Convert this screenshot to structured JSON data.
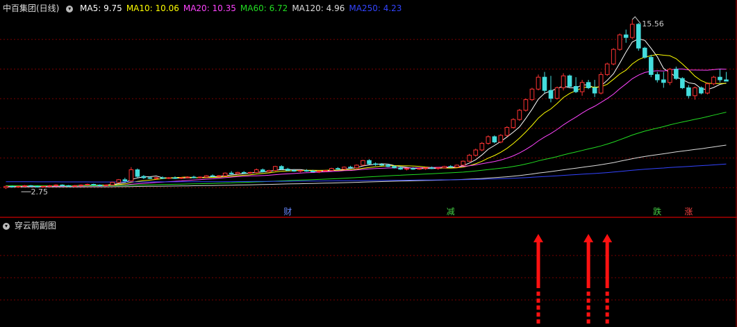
{
  "header": {
    "stock_name": "中百集团(日线)",
    "ma_labels": [
      {
        "label": "MA5: 9.75",
        "color": "#ffffff"
      },
      {
        "label": "MA10: 10.06",
        "color": "#ffff00"
      },
      {
        "label": "MA20: 10.35",
        "color": "#ff44ff"
      },
      {
        "label": "MA60: 6.72",
        "color": "#22dd22"
      },
      {
        "label": "MA120: 4.96",
        "color": "#dddddd"
      },
      {
        "label": "MA250: 4.23",
        "color": "#3344ff"
      }
    ]
  },
  "sub_panel": {
    "title": "穿云箭副图"
  },
  "chart_data": {
    "type": "candlestick",
    "price_ylim": [
      1.5,
      16.3
    ],
    "high_label": "15.56",
    "low_label": "2.75",
    "colors": {
      "up": "#ff3333",
      "down": "#44dddd",
      "grid": "#7a0000",
      "border": "#aa0000"
    },
    "candles": [
      {
        "o": 2.85,
        "h": 3.0,
        "l": 2.75,
        "c": 2.95
      },
      {
        "o": 2.95,
        "h": 3.0,
        "l": 2.85,
        "c": 2.9
      },
      {
        "o": 2.9,
        "h": 3.0,
        "l": 2.85,
        "c": 2.95
      },
      {
        "o": 2.95,
        "h": 3.05,
        "l": 2.9,
        "c": 3.0
      },
      {
        "o": 3.0,
        "h": 3.05,
        "l": 2.9,
        "c": 2.95
      },
      {
        "o": 2.95,
        "h": 3.0,
        "l": 2.85,
        "c": 2.9
      },
      {
        "o": 2.9,
        "h": 3.0,
        "l": 2.85,
        "c": 2.95
      },
      {
        "o": 2.95,
        "h": 3.05,
        "l": 2.9,
        "c": 3.0
      },
      {
        "o": 3.0,
        "h": 3.1,
        "l": 2.95,
        "c": 3.05
      },
      {
        "o": 3.05,
        "h": 3.1,
        "l": 2.95,
        "c": 3.0
      },
      {
        "o": 3.0,
        "h": 3.05,
        "l": 2.9,
        "c": 2.95
      },
      {
        "o": 2.95,
        "h": 3.05,
        "l": 2.9,
        "c": 3.0
      },
      {
        "o": 3.0,
        "h": 3.1,
        "l": 2.95,
        "c": 3.05
      },
      {
        "o": 3.05,
        "h": 3.15,
        "l": 3.0,
        "c": 3.1
      },
      {
        "o": 3.1,
        "h": 3.15,
        "l": 3.0,
        "c": 3.05
      },
      {
        "o": 3.05,
        "h": 3.1,
        "l": 2.95,
        "c": 3.0
      },
      {
        "o": 3.0,
        "h": 3.1,
        "l": 2.95,
        "c": 3.05
      },
      {
        "o": 3.05,
        "h": 3.3,
        "l": 3.0,
        "c": 3.25
      },
      {
        "o": 3.25,
        "h": 3.5,
        "l": 3.2,
        "c": 3.45
      },
      {
        "o": 3.45,
        "h": 3.6,
        "l": 3.3,
        "c": 3.35
      },
      {
        "o": 3.35,
        "h": 4.4,
        "l": 3.3,
        "c": 4.2
      },
      {
        "o": 4.2,
        "h": 4.3,
        "l": 3.6,
        "c": 3.7
      },
      {
        "o": 3.7,
        "h": 3.8,
        "l": 3.5,
        "c": 3.6
      },
      {
        "o": 3.6,
        "h": 3.7,
        "l": 3.5,
        "c": 3.55
      },
      {
        "o": 3.55,
        "h": 3.65,
        "l": 3.45,
        "c": 3.6
      },
      {
        "o": 3.6,
        "h": 3.7,
        "l": 3.5,
        "c": 3.55
      },
      {
        "o": 3.55,
        "h": 3.65,
        "l": 3.5,
        "c": 3.6
      },
      {
        "o": 3.6,
        "h": 3.7,
        "l": 3.5,
        "c": 3.55
      },
      {
        "o": 3.55,
        "h": 3.65,
        "l": 3.5,
        "c": 3.6
      },
      {
        "o": 3.6,
        "h": 3.7,
        "l": 3.55,
        "c": 3.65
      },
      {
        "o": 3.65,
        "h": 3.75,
        "l": 3.55,
        "c": 3.6
      },
      {
        "o": 3.6,
        "h": 3.7,
        "l": 3.55,
        "c": 3.65
      },
      {
        "o": 3.65,
        "h": 3.8,
        "l": 3.6,
        "c": 3.75
      },
      {
        "o": 3.75,
        "h": 3.85,
        "l": 3.65,
        "c": 3.7
      },
      {
        "o": 3.7,
        "h": 3.8,
        "l": 3.65,
        "c": 3.75
      },
      {
        "o": 3.75,
        "h": 4.0,
        "l": 3.7,
        "c": 3.95
      },
      {
        "o": 3.95,
        "h": 4.1,
        "l": 3.85,
        "c": 3.9
      },
      {
        "o": 3.9,
        "h": 4.05,
        "l": 3.85,
        "c": 4.0
      },
      {
        "o": 4.0,
        "h": 4.1,
        "l": 3.9,
        "c": 3.95
      },
      {
        "o": 3.95,
        "h": 4.05,
        "l": 3.9,
        "c": 4.0
      },
      {
        "o": 4.0,
        "h": 4.3,
        "l": 3.95,
        "c": 4.2
      },
      {
        "o": 4.2,
        "h": 4.3,
        "l": 4.0,
        "c": 4.05
      },
      {
        "o": 4.05,
        "h": 4.2,
        "l": 4.0,
        "c": 4.15
      },
      {
        "o": 4.15,
        "h": 4.5,
        "l": 4.1,
        "c": 4.45
      },
      {
        "o": 4.45,
        "h": 4.55,
        "l": 4.2,
        "c": 4.25
      },
      {
        "o": 4.25,
        "h": 4.35,
        "l": 4.1,
        "c": 4.15
      },
      {
        "o": 4.15,
        "h": 4.25,
        "l": 4.05,
        "c": 4.1
      },
      {
        "o": 4.1,
        "h": 4.2,
        "l": 4.0,
        "c": 4.15
      },
      {
        "o": 4.15,
        "h": 4.25,
        "l": 4.05,
        "c": 4.1
      },
      {
        "o": 4.1,
        "h": 4.2,
        "l": 4.0,
        "c": 4.05
      },
      {
        "o": 4.05,
        "h": 4.15,
        "l": 3.95,
        "c": 4.1
      },
      {
        "o": 4.1,
        "h": 4.2,
        "l": 4.05,
        "c": 4.15
      },
      {
        "o": 4.15,
        "h": 4.35,
        "l": 4.1,
        "c": 4.3
      },
      {
        "o": 4.3,
        "h": 4.4,
        "l": 4.2,
        "c": 4.25
      },
      {
        "o": 4.25,
        "h": 4.45,
        "l": 4.2,
        "c": 4.4
      },
      {
        "o": 4.4,
        "h": 4.5,
        "l": 4.3,
        "c": 4.35
      },
      {
        "o": 4.35,
        "h": 4.6,
        "l": 4.3,
        "c": 4.55
      },
      {
        "o": 4.55,
        "h": 4.95,
        "l": 4.5,
        "c": 4.9
      },
      {
        "o": 4.9,
        "h": 5.0,
        "l": 4.6,
        "c": 4.65
      },
      {
        "o": 4.65,
        "h": 4.75,
        "l": 4.5,
        "c": 4.6
      },
      {
        "o": 4.6,
        "h": 4.7,
        "l": 4.5,
        "c": 4.55
      },
      {
        "o": 4.55,
        "h": 4.65,
        "l": 4.4,
        "c": 4.45
      },
      {
        "o": 4.45,
        "h": 4.55,
        "l": 4.3,
        "c": 4.35
      },
      {
        "o": 4.35,
        "h": 4.45,
        "l": 4.2,
        "c": 4.25
      },
      {
        "o": 4.25,
        "h": 4.35,
        "l": 4.15,
        "c": 4.3
      },
      {
        "o": 4.3,
        "h": 4.4,
        "l": 4.2,
        "c": 4.25
      },
      {
        "o": 4.25,
        "h": 4.35,
        "l": 4.2,
        "c": 4.3
      },
      {
        "o": 4.3,
        "h": 4.4,
        "l": 4.2,
        "c": 4.35
      },
      {
        "o": 4.35,
        "h": 4.45,
        "l": 4.25,
        "c": 4.3
      },
      {
        "o": 4.3,
        "h": 4.4,
        "l": 4.2,
        "c": 4.35
      },
      {
        "o": 4.35,
        "h": 4.5,
        "l": 4.3,
        "c": 4.45
      },
      {
        "o": 4.45,
        "h": 4.55,
        "l": 4.35,
        "c": 4.4
      },
      {
        "o": 4.4,
        "h": 4.6,
        "l": 4.35,
        "c": 4.55
      },
      {
        "o": 4.55,
        "h": 4.9,
        "l": 4.5,
        "c": 4.85
      },
      {
        "o": 4.85,
        "h": 5.4,
        "l": 4.8,
        "c": 5.3
      },
      {
        "o": 5.3,
        "h": 5.8,
        "l": 5.2,
        "c": 5.7
      },
      {
        "o": 5.7,
        "h": 6.3,
        "l": 5.6,
        "c": 6.2
      },
      {
        "o": 6.2,
        "h": 6.8,
        "l": 6.1,
        "c": 6.7
      },
      {
        "o": 6.7,
        "h": 6.8,
        "l": 6.2,
        "c": 6.3
      },
      {
        "o": 6.3,
        "h": 6.9,
        "l": 6.2,
        "c": 6.8
      },
      {
        "o": 6.8,
        "h": 7.5,
        "l": 6.7,
        "c": 7.4
      },
      {
        "o": 7.4,
        "h": 8.1,
        "l": 7.3,
        "c": 8.0
      },
      {
        "o": 8.0,
        "h": 8.8,
        "l": 7.9,
        "c": 8.7
      },
      {
        "o": 8.7,
        "h": 9.6,
        "l": 8.6,
        "c": 9.5
      },
      {
        "o": 9.5,
        "h": 10.4,
        "l": 9.4,
        "c": 10.3
      },
      {
        "o": 10.3,
        "h": 11.4,
        "l": 10.2,
        "c": 11.2
      },
      {
        "o": 11.2,
        "h": 11.6,
        "l": 10.0,
        "c": 10.2
      },
      {
        "o": 10.2,
        "h": 11.3,
        "l": 9.3,
        "c": 9.6
      },
      {
        "o": 9.6,
        "h": 10.5,
        "l": 9.5,
        "c": 10.4
      },
      {
        "o": 10.4,
        "h": 11.5,
        "l": 10.2,
        "c": 11.3
      },
      {
        "o": 11.3,
        "h": 11.4,
        "l": 10.4,
        "c": 10.5
      },
      {
        "o": 10.5,
        "h": 11.2,
        "l": 10.0,
        "c": 10.1
      },
      {
        "o": 10.1,
        "h": 11.0,
        "l": 9.8,
        "c": 10.8
      },
      {
        "o": 10.8,
        "h": 11.0,
        "l": 10.3,
        "c": 10.4
      },
      {
        "o": 10.4,
        "h": 11.0,
        "l": 9.7,
        "c": 10.0
      },
      {
        "o": 10.0,
        "h": 11.6,
        "l": 9.9,
        "c": 11.4
      },
      {
        "o": 11.4,
        "h": 12.3,
        "l": 11.3,
        "c": 12.2
      },
      {
        "o": 12.2,
        "h": 13.4,
        "l": 12.1,
        "c": 13.3
      },
      {
        "o": 13.3,
        "h": 14.5,
        "l": 13.2,
        "c": 14.4
      },
      {
        "o": 14.4,
        "h": 14.8,
        "l": 13.8,
        "c": 14.2
      },
      {
        "o": 14.2,
        "h": 15.56,
        "l": 14.1,
        "c": 15.2
      },
      {
        "o": 15.2,
        "h": 15.3,
        "l": 13.2,
        "c": 13.4
      },
      {
        "o": 13.4,
        "h": 13.5,
        "l": 12.6,
        "c": 12.7
      },
      {
        "o": 12.7,
        "h": 12.9,
        "l": 11.2,
        "c": 11.4
      },
      {
        "o": 11.4,
        "h": 11.6,
        "l": 10.8,
        "c": 11.0
      },
      {
        "o": 11.0,
        "h": 11.6,
        "l": 10.4,
        "c": 10.8
      },
      {
        "o": 10.8,
        "h": 11.9,
        "l": 10.6,
        "c": 11.8
      },
      {
        "o": 11.8,
        "h": 12.0,
        "l": 11.0,
        "c": 11.1
      },
      {
        "o": 11.1,
        "h": 11.2,
        "l": 10.3,
        "c": 10.4
      },
      {
        "o": 10.4,
        "h": 10.6,
        "l": 9.6,
        "c": 9.8
      },
      {
        "o": 9.8,
        "h": 10.5,
        "l": 9.5,
        "c": 10.4
      },
      {
        "o": 10.4,
        "h": 10.5,
        "l": 9.9,
        "c": 10.0
      },
      {
        "o": 10.0,
        "h": 10.8,
        "l": 9.9,
        "c": 10.7
      },
      {
        "o": 10.7,
        "h": 11.3,
        "l": 10.6,
        "c": 11.2
      },
      {
        "o": 11.2,
        "h": 11.8,
        "l": 10.8,
        "c": 11.0
      },
      {
        "o": 11.0,
        "h": 11.6,
        "l": 10.9,
        "c": 10.9
      }
    ],
    "markers": [
      {
        "label": "财",
        "color": "#6688ff",
        "index": 45
      },
      {
        "label": "减",
        "color": "#44cc44",
        "index": 71
      },
      {
        "label": "跌",
        "color": "#44cc44",
        "index": 104
      },
      {
        "label": "涨",
        "color": "#ff4444",
        "index": 109
      }
    ],
    "arrow_signals": [
      85,
      93,
      96
    ]
  }
}
